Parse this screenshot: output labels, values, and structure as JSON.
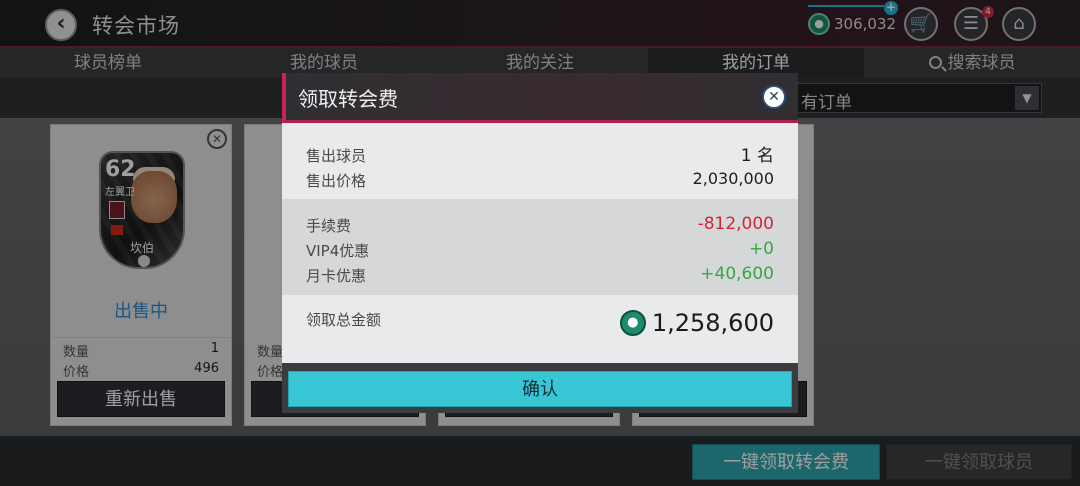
{
  "header": {
    "title": "转会市场",
    "coins": "306,032",
    "notification_count": "4",
    "icons": [
      "back-icon",
      "coin-icon",
      "cart-icon",
      "menu-list-icon",
      "home-icon"
    ]
  },
  "tabs": [
    {
      "label": "球员榜单"
    },
    {
      "label": "我的球员"
    },
    {
      "label": "我的关注"
    },
    {
      "label": "我的订单"
    },
    {
      "label": "搜索球员"
    }
  ],
  "filter": {
    "selected": "有订单"
  },
  "cards": [
    {
      "rating": "62",
      "position": "左翼卫",
      "player_name": "坎伯",
      "status": "出售中",
      "qty_label": "数量",
      "qty": "1",
      "price_label": "价格",
      "price": "496",
      "action": "重新出售"
    },
    {
      "qty_label": "数量",
      "price_label": "价格"
    }
  ],
  "footer": {
    "claim_fee": "一键领取转会费",
    "claim_player": "一键领取球员"
  },
  "modal": {
    "title": "领取转会费",
    "sold_players_label": "售出球员",
    "sold_players_value": "1",
    "sold_players_unit": "名",
    "sold_price_label": "售出价格",
    "sold_price_value": "2,030,000",
    "fee_label": "手续费",
    "fee_value": "-812,000",
    "vip_label": "VIP4优惠",
    "vip_value": "+0",
    "monthly_label": "月卡优惠",
    "monthly_value": "+40,600",
    "total_label": "领取总金额",
    "total_value": "1,258,600",
    "confirm": "确认"
  },
  "colors": {
    "accent_pink": "#c8245a",
    "teal_button": "#38c6d4",
    "negative": "#d3253a",
    "positive": "#34a845",
    "status_blue": "#2c8fd0"
  }
}
